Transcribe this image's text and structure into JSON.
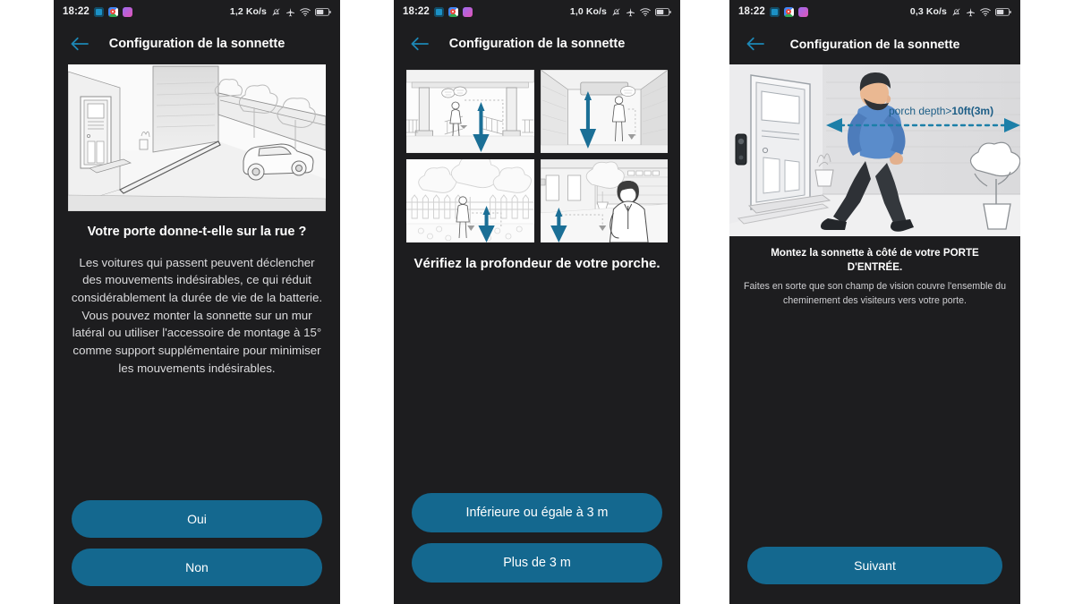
{
  "screens": [
    {
      "id": "screen-street-question",
      "statusbar": {
        "time": "18:22",
        "network_speed": "1,2 Ko/s",
        "battery_level": "39",
        "icons": [
          "notification-app-icon",
          "google-icon",
          "photos-icon",
          "bell-muted-icon",
          "airplane-mode-icon",
          "wifi-icon",
          "battery-icon"
        ]
      },
      "header": {
        "title": "Configuration de la sonnette",
        "back": "back-arrow"
      },
      "illustration_alt": "Vue d'une allée menant à une porte d'entrée avec une voiture dans la rue",
      "title": "Votre porte donne-t-elle sur la rue ?",
      "body": "Les voitures qui passent peuvent déclencher des mouvements indésirables, ce qui réduit considérablement la durée de vie de la batterie.\nVous pouvez monter la sonnette sur un mur latéral ou utiliser l'accessoire de montage à 15° comme support supplémentaire pour minimiser les mouvements indésirables.",
      "buttons": [
        {
          "name": "yes-button",
          "label": "Oui"
        },
        {
          "name": "no-button",
          "label": "Non"
        }
      ]
    },
    {
      "id": "screen-porch-depth",
      "statusbar": {
        "time": "18:22",
        "network_speed": "1,0 Ko/s",
        "battery_level": "39"
      },
      "header": {
        "title": "Configuration de la sonnette",
        "back": "back-arrow"
      },
      "thumbs": [
        {
          "name": "thumb-columned-porch",
          "alt": "Porche avec colonnes et personne, flèche bleue vers le bas"
        },
        {
          "name": "thumb-covered-entry",
          "alt": "Entrée couverte étroite avec personne, flèche bleue"
        },
        {
          "name": "thumb-open-yard",
          "alt": "Jardin ouvert avec clôture, arbre et personne, flèche bleue"
        },
        {
          "name": "thumb-garage-driveway",
          "alt": "Allée de garage avec personne en gros plan, flèche bleue"
        }
      ],
      "title": "Vérifiez la profondeur de votre porche.",
      "buttons": [
        {
          "name": "depth-le-3m-button",
          "label": "Inférieure ou égale à 3 m"
        },
        {
          "name": "depth-gt-3m-button",
          "label": "Plus de 3 m"
        }
      ]
    },
    {
      "id": "screen-mount-location",
      "statusbar": {
        "time": "18:22",
        "network_speed": "0,3 Ko/s",
        "battery_level": "39"
      },
      "header": {
        "title": "Configuration de la sonnette",
        "back": "back-arrow"
      },
      "illustration_alt": "Homme marchant devant une porte d'entrée, mesure de la profondeur du porche",
      "illustration_label": "porch depth>10ft(3m)",
      "title": "Montez la sonnette à côté de votre PORTE D'ENTRÉE.",
      "body": "Faites en sorte que son champ de vision couvre l'ensemble du cheminement des visiteurs vers votre porte.",
      "buttons": [
        {
          "name": "next-button",
          "label": "Suivant"
        }
      ]
    }
  ],
  "colors": {
    "screen_background": "#1d1d1f",
    "button_fill": "#14688f",
    "accent_blue": "#1c7fa8",
    "title_text": "#ffffff",
    "body_text": "#dcdcde"
  }
}
